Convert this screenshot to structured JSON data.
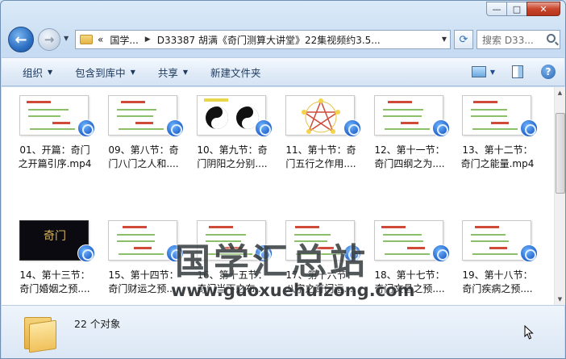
{
  "window": {
    "caption_min": "—",
    "caption_max": "□",
    "caption_close": "✕"
  },
  "nav": {
    "back_glyph": "←",
    "forward_glyph": "→",
    "breadcrumb_lead": "«",
    "breadcrumbs": [
      "国学...",
      "D33387 胡满《奇门测算大讲堂》22集视频约3.5..."
    ],
    "search_placeholder": "搜索 D33...",
    "refresh_glyph": "⟳"
  },
  "toolbar": {
    "organize": "组织",
    "include_library": "包含到库中",
    "share": "共享",
    "new_folder": "新建文件夹"
  },
  "files": [
    {
      "line1": "01、开篇：奇门",
      "line2": "之开篇引序.mp4",
      "thumb": "light"
    },
    {
      "line1": "09、第八节：奇",
      "line2": "门八门之人和....",
      "thumb": "light"
    },
    {
      "line1": "10、第九节：奇",
      "line2": "门阴阳之分别....",
      "thumb": "yinyang"
    },
    {
      "line1": "11、第十节：奇",
      "line2": "门五行之作用....",
      "thumb": "star"
    },
    {
      "line1": "12、第十一节：",
      "line2": "奇门四纲之为....",
      "thumb": "light"
    },
    {
      "line1": "13、第十二节：",
      "line2": "奇门之能量.mp4",
      "thumb": "light"
    },
    {
      "line1": "14、第十三节：",
      "line2": "奇门婚姻之预....",
      "thumb": "dark"
    },
    {
      "line1": "15、第十四节：",
      "line2": "奇门财运之预....",
      "thumb": "light"
    },
    {
      "line1": "16、第十五节：",
      "line2": "奇门当下之布....",
      "thumb": "light"
    },
    {
      "line1": "17、第十六节：",
      "line2": "八字之奇门运....",
      "thumb": "light"
    },
    {
      "line1": "18、第十七节：",
      "line2": "奇门文昌之预....",
      "thumb": "light"
    },
    {
      "line1": "19、第十八节：",
      "line2": "奇门疾病之预....",
      "thumb": "light"
    }
  ],
  "dark_thumb_text": "奇门",
  "watermark": {
    "cn": "国学汇总站",
    "url": "www.guoxuehuizong.com"
  },
  "details": {
    "count": "22 个对象"
  },
  "colors": {
    "accent": "#2d6fc2",
    "toolbar_text": "#1e395b",
    "thumb_red": "#d04a3a",
    "thumb_green": "#8bbf6a"
  }
}
